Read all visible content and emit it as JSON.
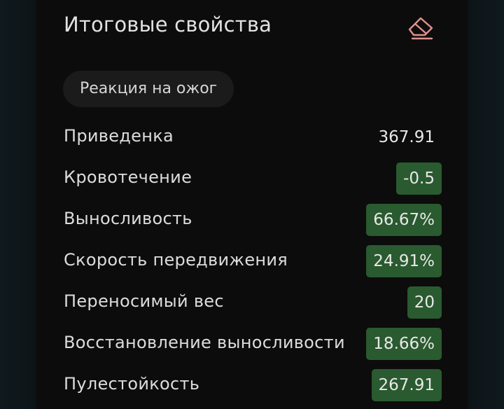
{
  "panel": {
    "title": "Итоговые свойства",
    "clear_icon": "eraser-icon"
  },
  "filter_chip": {
    "label": "Реакция на ожог"
  },
  "colors": {
    "highlight_bg": "#2a5a2f",
    "eraser_stroke": "#e0918c"
  },
  "properties": [
    {
      "label": "Приведенка",
      "value": "367.91",
      "highlighted": false
    },
    {
      "label": "Кровотечение",
      "value": "-0.5",
      "highlighted": true
    },
    {
      "label": "Выносливость",
      "value": "66.67%",
      "highlighted": true
    },
    {
      "label": "Скорость передвижения",
      "value": "24.91%",
      "highlighted": true
    },
    {
      "label": "Переносимый вес",
      "value": "20",
      "highlighted": true
    },
    {
      "label": "Восстановление выносливости",
      "value": "18.66%",
      "highlighted": true
    },
    {
      "label": "Пулестойкость",
      "value": "267.91",
      "highlighted": true
    }
  ]
}
